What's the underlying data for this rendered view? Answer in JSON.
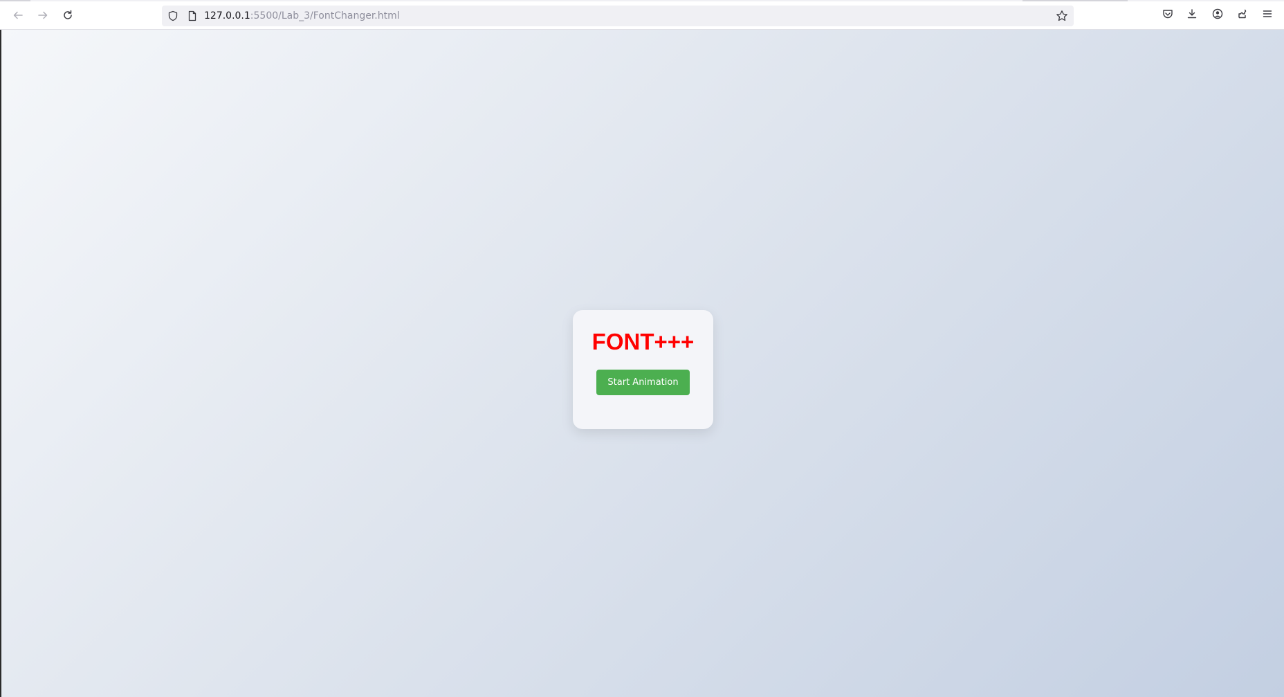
{
  "browser": {
    "url_host": "127.0.0.1",
    "url_rest": ":5500/Lab_3/FontChanger.html",
    "icons": {
      "back": "arrow-left-icon",
      "forward": "arrow-right-icon",
      "reload": "reload-icon",
      "tracking_protection": "shield-icon",
      "page": "page-icon",
      "bookmark": "star-icon",
      "pocket": "pocket-icon",
      "downloads": "download-icon",
      "account": "account-icon",
      "extensions": "extensions-icon",
      "menu": "hamburger-menu-icon"
    }
  },
  "page": {
    "heading": "FONT+++",
    "button_label": "Start Animation",
    "heading_color": "#ff0000",
    "button_color": "#4caf50"
  }
}
